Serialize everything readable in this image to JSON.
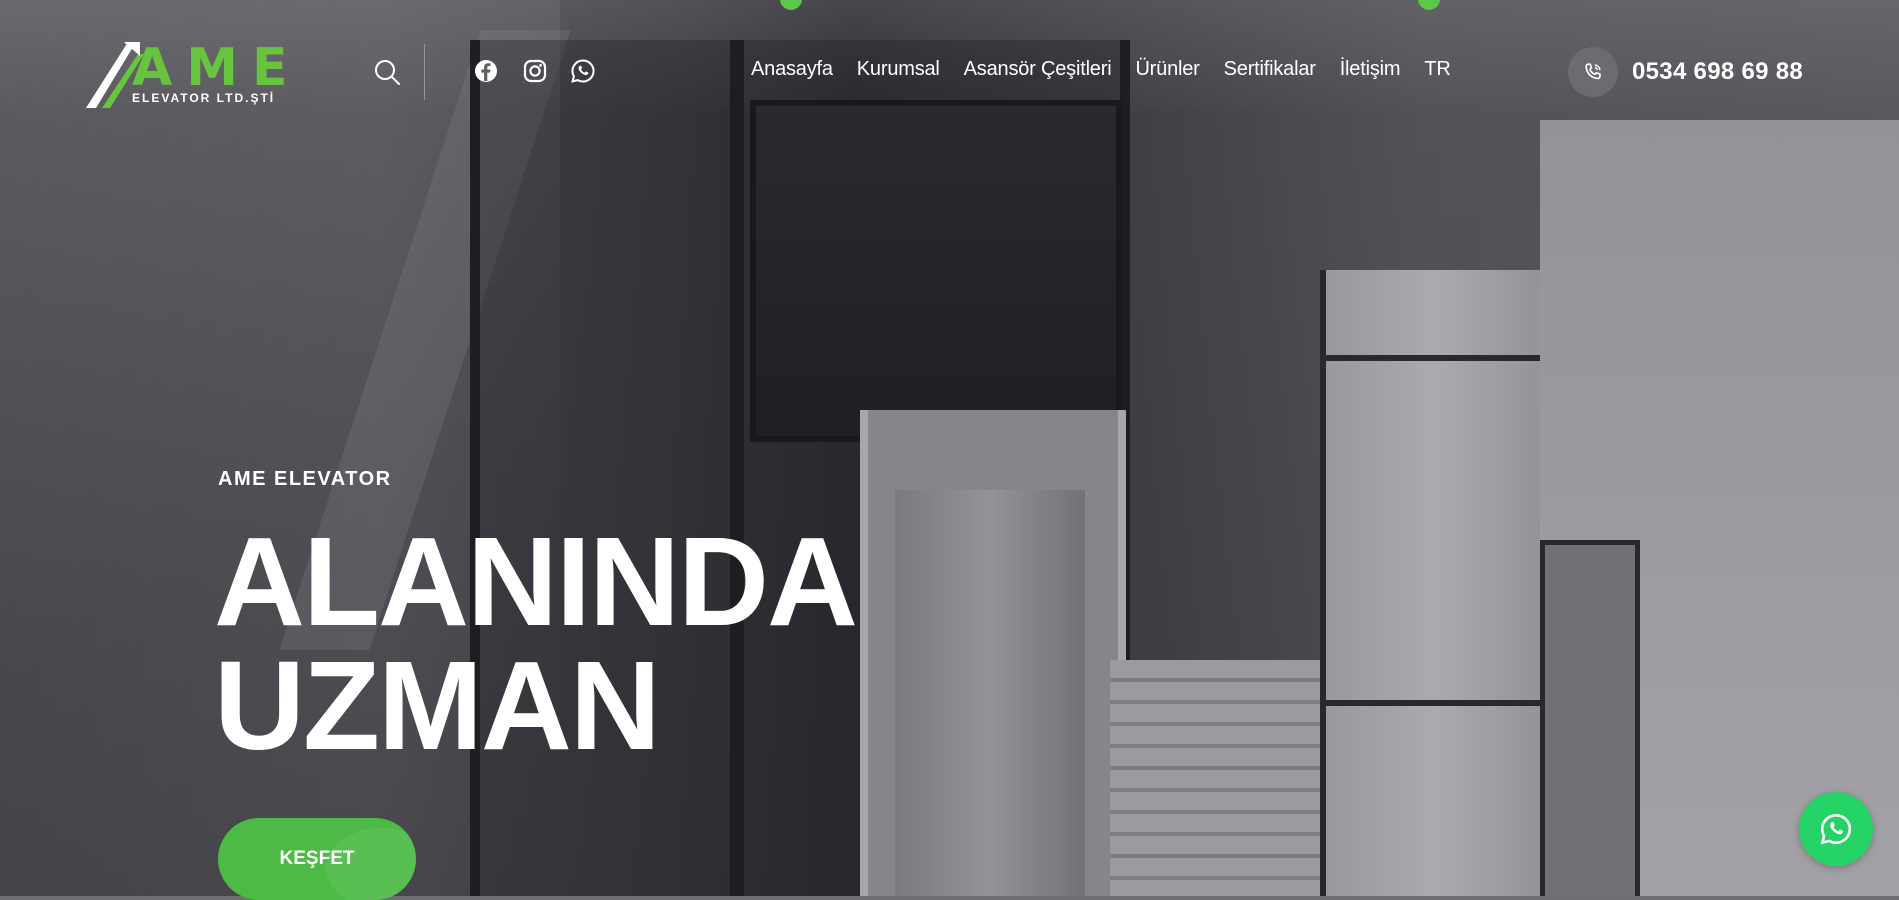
{
  "brand": {
    "logo_letters": "AME",
    "logo_tagline": "ELEVATOR LTD.ŞTİ",
    "accent_color": "#5cc84a",
    "whatsapp_color": "#25d366"
  },
  "header": {
    "search_icon": "search-icon",
    "social": [
      {
        "name": "facebook-icon"
      },
      {
        "name": "instagram-icon"
      },
      {
        "name": "whatsapp-icon"
      }
    ],
    "nav": [
      {
        "label": "Anasayfa"
      },
      {
        "label": "Kurumsal"
      },
      {
        "label": "Asansör Çeşitleri"
      },
      {
        "label": "Ürünler"
      },
      {
        "label": "Sertifikalar"
      },
      {
        "label": "İletişim"
      },
      {
        "label": "TR"
      }
    ],
    "phone": {
      "icon": "phone-icon",
      "number": "0534 698 69 88"
    }
  },
  "hero": {
    "eyebrow": "AME ELEVATOR",
    "headline_line1": "ALANINDA",
    "headline_line2": "UZMAN",
    "cta_label": "KEŞFET"
  },
  "floating": {
    "whatsapp_icon": "whatsapp-icon"
  }
}
